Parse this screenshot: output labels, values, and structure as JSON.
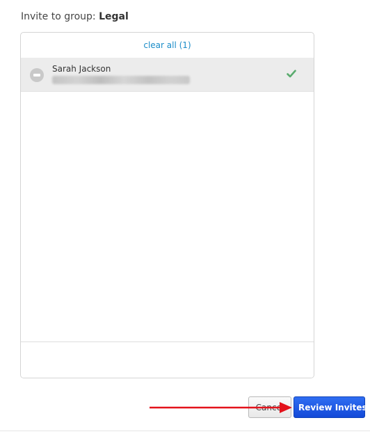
{
  "header": {
    "prefix": "Invite to group:",
    "group_name": "Legal"
  },
  "panel": {
    "clear_all_label": "clear all",
    "clear_all_count": "(1)",
    "invitees": [
      {
        "name": "Sarah Jackson",
        "email_redacted": true,
        "status": "added"
      }
    ]
  },
  "actions": {
    "cancel_label": "Cancel",
    "review_label": "Review Invites"
  },
  "annotation": {
    "arrow_color": "#e3121b",
    "points_to": "review-invites-button"
  },
  "colors": {
    "link": "#1a8cc8",
    "primary_button": "#1a55e3",
    "check": "#5aab6e",
    "selected_row": "#ececec"
  },
  "icons": {
    "remove": "minus-circle-icon",
    "status": "check-icon"
  }
}
